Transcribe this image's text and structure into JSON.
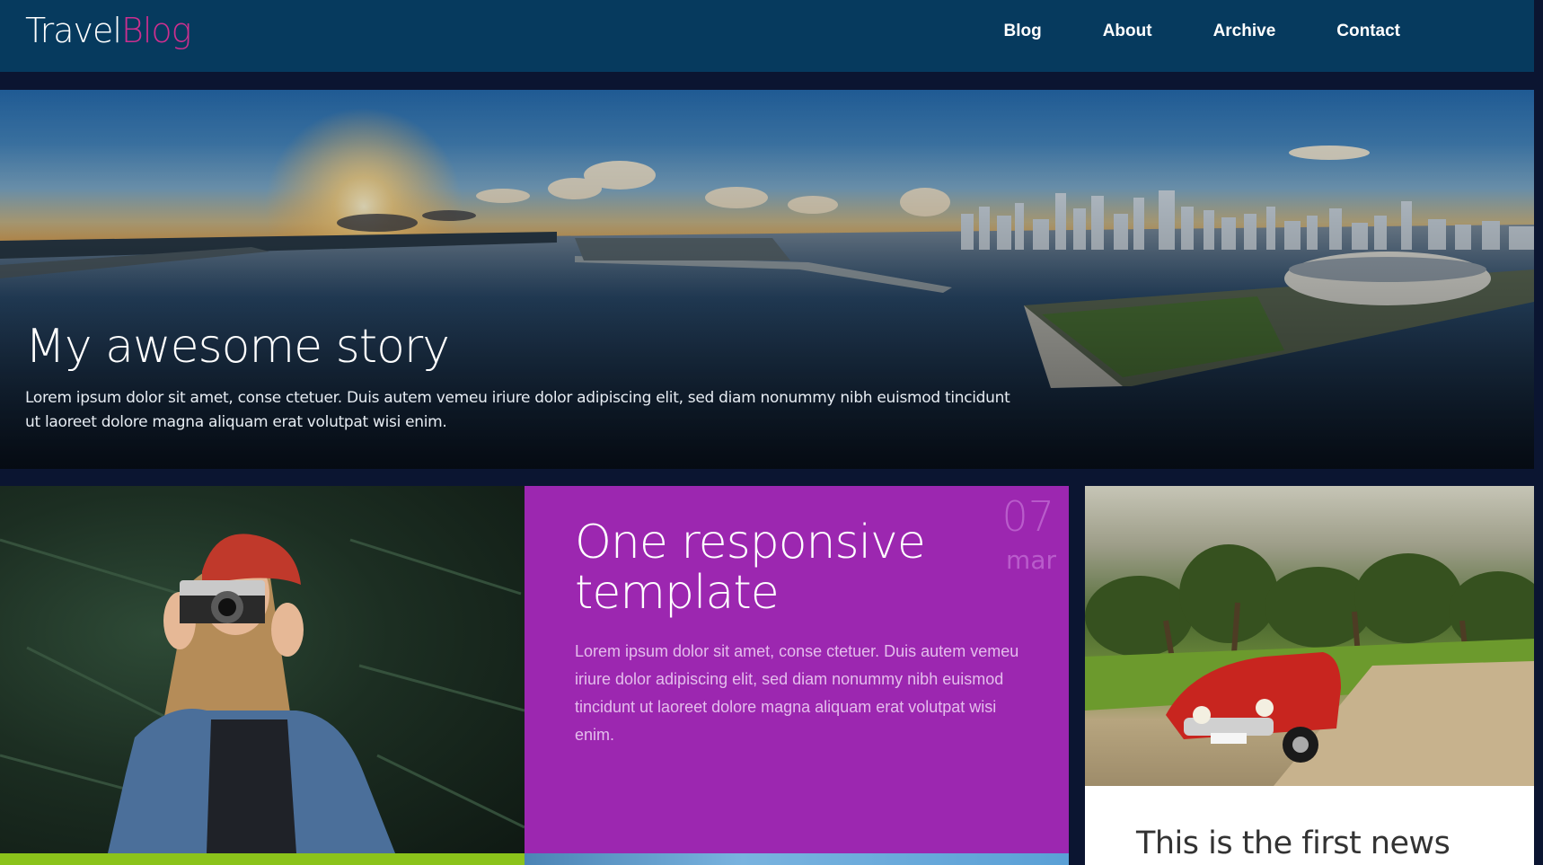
{
  "header": {
    "logo_part1": "Travel",
    "logo_part2": "Blog",
    "nav": [
      "Blog",
      "About",
      "Archive",
      "Contact"
    ]
  },
  "hero": {
    "title": "My awesome story",
    "text": "Lorem ipsum dolor sit amet, conse ctetuer. Duis autem vemeu iriure dolor adipiscing elit, sed diam nonummy nibh euismod tincidunt ut laoreet dolore magna aliquam erat volutpat wisi enim."
  },
  "featured": {
    "date_day": "07",
    "date_month": "mar",
    "title": "One responsive template",
    "text": "Lorem ipsum dolor sit amet, conse ctetuer. Duis autem vemeu iriure dolor adipiscing elit, sed diam nonummy nibh euismod tincidunt ut laoreet dolore magna aliquam erat volutpat wisi enim."
  },
  "news": {
    "title": "This is the first news"
  },
  "colors": {
    "header_bg": "#063a5e",
    "logo_accent": "#cc2f8f",
    "featured_bg": "#9c27b0",
    "green_accent": "#8bc31b"
  }
}
